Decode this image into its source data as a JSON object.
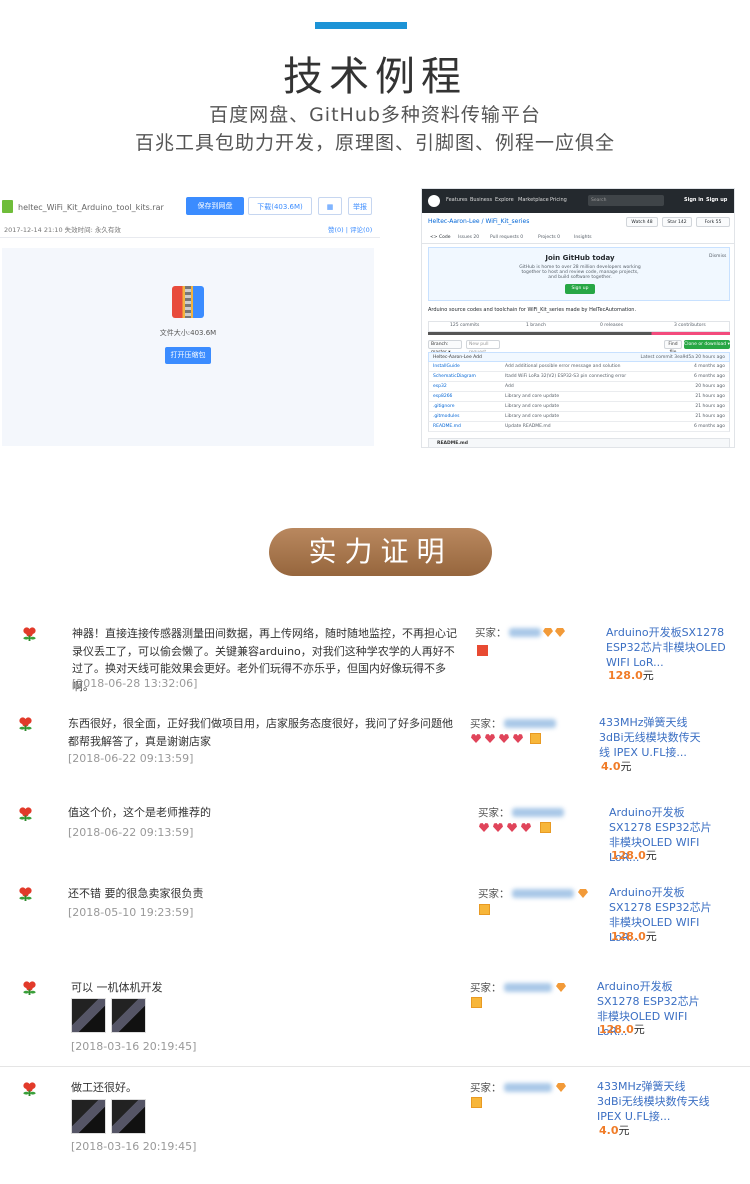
{
  "header": {
    "title": "技术例程",
    "subtitle1": "百度网盘、GitHub多种资料传输平台",
    "subtitle2": "百兆工具包助力开发，原理图、引脚图、例程一应俱全"
  },
  "baidupan": {
    "filename": "heltec_WiFi_Kit_Arduino_tool_kits.rar",
    "meta": "2017-12-14 21:10    失效时间: 永久有效",
    "save_label": "保存到网盘",
    "download_label": "下载(403.6M)",
    "qr_label": "▦",
    "report_label": "举报",
    "links": "赞(0) | 评论(0)",
    "size_label": "文件大小:403.6M",
    "open_label": "打开压缩包"
  },
  "github": {
    "nav": [
      "Features",
      "Business",
      "Explore",
      "Marketplace",
      "Pricing"
    ],
    "search_placeholder": "Search",
    "signin": "Sign in",
    "signup": "Sign up",
    "repo": "Heltec-Aaron-Lee / WiFi_Kit_series",
    "watch": "Watch 48",
    "star": "Star 142",
    "fork": "Fork 55",
    "tabs": [
      "<> Code",
      "Issues 20",
      "Pull requests 0",
      "Projects 0",
      "Insights"
    ],
    "join_title": "Join GitHub today",
    "join_desc": "GitHub is home to over 28 million developers working together to host and review code, manage projects, and build software together.",
    "signup_btn": "Sign up",
    "dismiss": "Dismiss",
    "description": "Arduino source codes and toolchain for WiFi_Kit_series made by HelTecAutomation.",
    "stats": [
      "125 commits",
      "1 branch",
      "0 releases",
      "3 contributors"
    ],
    "branch": "Branch: master ▾",
    "new_pr": "New pull request",
    "find_file": "Find file",
    "clone": "Clone or download ▾",
    "latest_commit": "Heltec-Aaron-Lee Add",
    "latest_commit_right": "Latest commit 3ea9d5a 20 hours ago",
    "files": [
      {
        "name": "InstallGuide",
        "msg": "Add additional possible error message and solution",
        "time": "4 months ago"
      },
      {
        "name": "SchematicDiagram",
        "msg": "Itadd WiFi LoRa 32(V2) ESP32-S3 pin connecting error",
        "time": "6 months ago"
      },
      {
        "name": "esp32",
        "msg": "Add",
        "time": "20 hours ago"
      },
      {
        "name": "esp8266",
        "msg": "Library and core update",
        "time": "21 hours ago"
      },
      {
        "name": ".gitignore",
        "msg": "Library and core update",
        "time": "21 hours ago"
      },
      {
        "name": ".gitmodules",
        "msg": "Library and core update",
        "time": "21 hours ago"
      },
      {
        "name": "README.md",
        "msg": "Update README.md",
        "time": "6 months ago"
      }
    ],
    "readme": "README.md"
  },
  "proof_label": "实力证明",
  "reviews": [
    {
      "text": "神器！直接连接传感器测量田间数据，再上传网络，随时随地监控，不再担心记录仪丢工了，可以偷会懒了。关键兼容arduino，对我们这种学农学的人再好不过了。换对天线可能效果会更好。老外们玩得不亦乐乎，但国内好像玩得不多啊。",
      "date": "[2018-06-28 13:32:06]",
      "buyer": "买家：",
      "product": "Arduino开发板SX1278 ESP32芯片非模块OLED WIFI LoR...",
      "price": "128.0",
      "unit": "元"
    },
    {
      "text": "东西很好，很全面，正好我们做项目用，店家服务态度很好，我问了好多问题他都帮我解答了，真是谢谢店家",
      "date": "[2018-06-22 09:13:59]",
      "buyer": "买家：",
      "product": "433MHz弹簧天线 3dBi无线模块数传天线 IPEX U.FL接...",
      "price": "4.0",
      "unit": "元"
    },
    {
      "text": "值这个价，这个是老师推荐的",
      "date": "[2018-06-22 09:13:59]",
      "buyer": "买家：",
      "product": "Arduino开发板SX1278 ESP32芯片非模块OLED WIFI LoR...",
      "price": "128.0",
      "unit": "元"
    },
    {
      "text": "还不错 要的很急卖家很负责",
      "date": "[2018-05-10 19:23:59]",
      "buyer": "买家：",
      "product": "Arduino开发板SX1278 ESP32芯片非模块OLED WIFI LoR...",
      "price": "128.0",
      "unit": "元"
    },
    {
      "text": "可以 一机体机开发",
      "date": "[2018-03-16 20:19:45]",
      "buyer": "买家：",
      "product": "Arduino开发板SX1278 ESP32芯片非模块OLED WIFI LoR...",
      "price": "128.0",
      "unit": "元"
    },
    {
      "text": "做工还很好。",
      "date": "[2018-03-16 20:19:45]",
      "buyer": "买家：",
      "product": "433MHz弹簧天线 3dBi无线模块数传天线 IPEX U.FL接...",
      "price": "4.0",
      "unit": "元"
    }
  ]
}
